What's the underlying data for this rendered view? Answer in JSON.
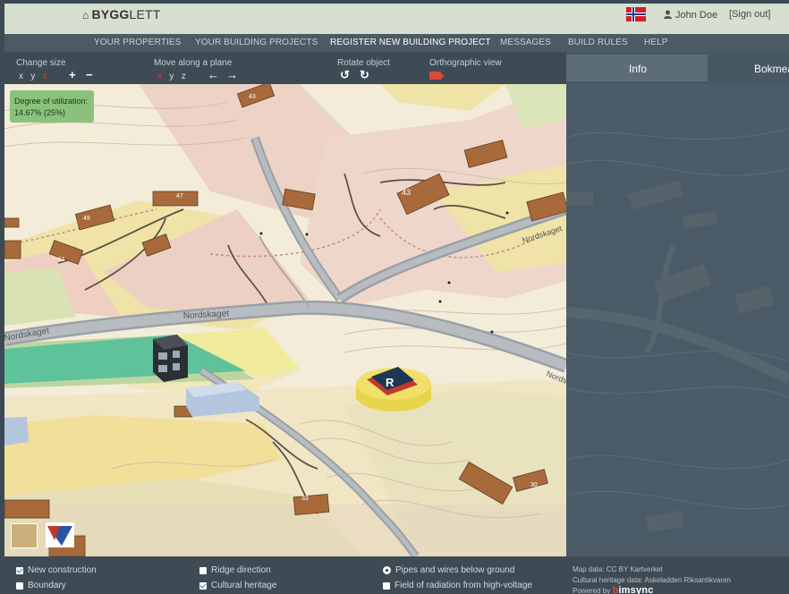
{
  "header": {
    "brand_prefix": "BYGG",
    "brand_suffix": "LETT",
    "user_name": "John Doe",
    "sign_out": "[Sign out]"
  },
  "nav": {
    "items": [
      {
        "label": "YOUR PROPERTIES"
      },
      {
        "label": "YOUR BUILDING PROJECTS"
      },
      {
        "label": "REGISTER NEW BUILDING PROJECT",
        "active": true
      },
      {
        "label": "MESSAGES"
      },
      {
        "label": "BUILD RULES"
      },
      {
        "label": "HELP"
      }
    ]
  },
  "toolbar": {
    "change_size": "Change size",
    "move_plane": "Move along a plane",
    "rotate": "Rotate object",
    "ortho": "Orthographic view",
    "axis_x": "x",
    "axis_y": "y",
    "axis_z": "z",
    "plus": "+",
    "minus": "−",
    "left_arrow": "←",
    "right_arrow": "→",
    "rotate_ccw": "↺",
    "rotate_cw": "↻"
  },
  "panel_tabs": {
    "info": "Info",
    "bokmal": "Bokmeal"
  },
  "utilization": {
    "label": "Degree of utilization:",
    "value": "14.67% (25%)"
  },
  "map_labels": {
    "road1": "Nordskaget",
    "road2": "Nordskaget",
    "road3": "Nordskaget",
    "road4": "Nordskaget",
    "marker": "R",
    "h43a": "43",
    "h47": "47",
    "h49": "49",
    "h51": "51",
    "h43b": "43",
    "h33": "33",
    "h30": "30"
  },
  "options": {
    "new_construction": "New construction",
    "boundary": "Boundary",
    "ridge_direction": "Ridge direction",
    "cultural_heritage": "Cultural heritage",
    "pipes": "Pipes and wires below ground",
    "radiation": "Field of radiation from high-voltage"
  },
  "credits": {
    "map": "Map data: CC BY Kartverket",
    "heritage": "Cultural heritage data: Askeladden Riksantikvaren",
    "powered": "Powered by",
    "bimsync_b": "b",
    "bimsync_rest": "imsync"
  },
  "colors": {
    "accent_red": "#d94b39",
    "header_bg": "#d6dfd0",
    "nav_bg": "#4b5a63",
    "utilization_bg": "#8ac27b"
  }
}
